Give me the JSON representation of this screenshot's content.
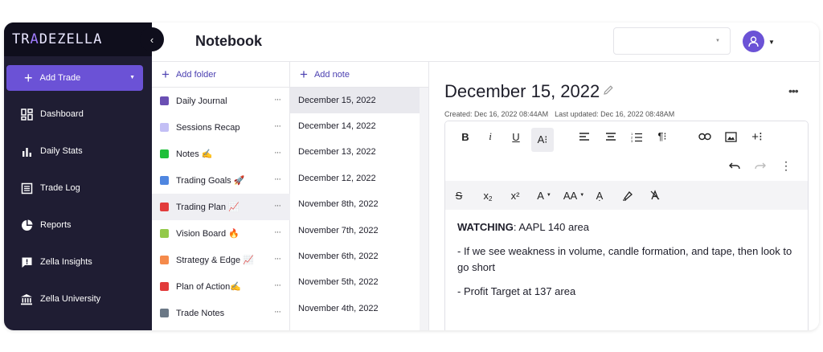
{
  "sidebar": {
    "logo": {
      "prefix": "TR",
      "mark": "A",
      "suffix": "DEZELLA"
    },
    "add_trade": "Add Trade",
    "items": [
      {
        "label": "Dashboard",
        "icon": "dashboard-icon"
      },
      {
        "label": "Daily Stats",
        "icon": "bar-chart-icon"
      },
      {
        "label": "Trade Log",
        "icon": "list-icon"
      },
      {
        "label": "Reports",
        "icon": "pie-chart-icon"
      },
      {
        "label": "Zella Insights",
        "icon": "insight-icon"
      },
      {
        "label": "Zella University",
        "icon": "university-icon"
      }
    ]
  },
  "header": {
    "title": "Notebook"
  },
  "folders": {
    "add_label": "Add folder",
    "items": [
      {
        "label": "Daily Journal",
        "color": "#6a4fb3"
      },
      {
        "label": "Sessions Recap",
        "color": "#c3bff5"
      },
      {
        "label": "Notes ✍️",
        "color": "#1fbf3a"
      },
      {
        "label": "Trading Goals 🚀",
        "color": "#4f86e0"
      },
      {
        "label": "Trading Plan 📈",
        "color": "#e23b3b"
      },
      {
        "label": "Vision Board 🔥",
        "color": "#93c94a"
      },
      {
        "label": "Strategy & Edge 📈",
        "color": "#f58a4b"
      },
      {
        "label": "Plan of Action✍️",
        "color": "#e23b3b"
      },
      {
        "label": "Trade Notes",
        "color": "#6b7886"
      }
    ]
  },
  "notes": {
    "add_label": "Add note",
    "items": [
      "December 15, 2022",
      "December 14, 2022",
      "December 13, 2022",
      "December 12, 2022",
      "November 8th, 2022",
      "November 7th, 2022",
      "November 6th, 2022",
      "November 5th, 2022",
      "November 4th, 2022"
    ]
  },
  "editor": {
    "title": "December 15, 2022",
    "created": "Created: Dec 16, 2022 08:44AM",
    "updated": "Last updated: Dec 16, 2022 08:48AM",
    "toolbar": {
      "bold": "B",
      "italic": "i",
      "underline": "U",
      "font_size": "A⁝",
      "superscript": "x²",
      "subscript_base": "x",
      "subscript_mark": "2",
      "font_color": "A",
      "text_size": "AA"
    },
    "content": {
      "watching_label": "WATCHING",
      "watching_text": ": AAPL 140 area",
      "line2": "- If we see weakness in volume, candle formation, and tape, then look to go short",
      "line3": "- Profit Target at 137 area"
    }
  },
  "colors": {
    "accent": "#6b52d6",
    "sidebar_bg": "#1f1d33",
    "link": "#4a3fb0"
  }
}
